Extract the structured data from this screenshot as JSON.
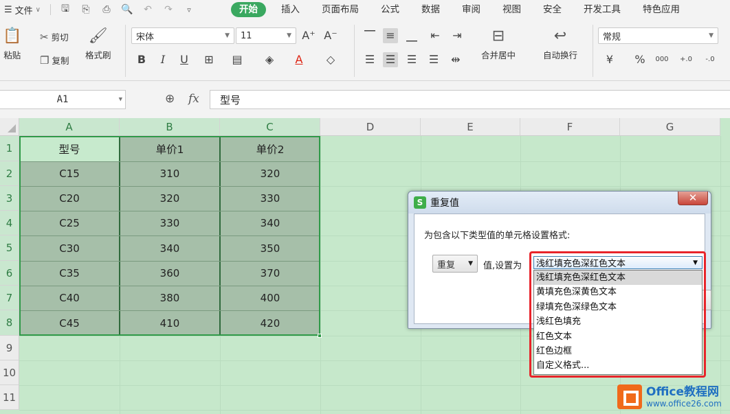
{
  "menubar": {
    "file_label": "文件",
    "tabs": [
      "开始",
      "插入",
      "页面布局",
      "公式",
      "数据",
      "审阅",
      "视图",
      "安全",
      "开发工具",
      "特色应用"
    ],
    "active_tab": "开始"
  },
  "ribbon": {
    "paste": "粘贴",
    "cut": "剪切",
    "copy": "复制",
    "format_painter": "格式刷",
    "font_name": "宋体",
    "font_size": "11",
    "grow_font": "A⁺",
    "shrink_font": "A⁻",
    "bold": "B",
    "italic": "I",
    "underline": "U",
    "merge_center": "合并居中",
    "wrap_text": "自动换行",
    "number_format": "常规",
    "percent": "%",
    "thousands": "000",
    "inc_decimal": "+.0",
    "dec_decimal": "-.0"
  },
  "formula_bar": {
    "name_box": "A1",
    "fx": "fx",
    "content": "型号"
  },
  "sheet": {
    "columns": [
      "A",
      "B",
      "C",
      "D",
      "E",
      "F",
      "G"
    ],
    "rows": [
      "1",
      "2",
      "3",
      "4",
      "5",
      "6",
      "7",
      "8",
      "9",
      "10",
      "11"
    ],
    "header": [
      "型号",
      "单价1",
      "单价2"
    ],
    "data": [
      [
        "C15",
        "310",
        "320"
      ],
      [
        "C20",
        "320",
        "330"
      ],
      [
        "C25",
        "330",
        "340"
      ],
      [
        "C30",
        "340",
        "350"
      ],
      [
        "C35",
        "360",
        "370"
      ],
      [
        "C40",
        "380",
        "400"
      ],
      [
        "C45",
        "410",
        "420"
      ]
    ]
  },
  "dialog": {
    "title": "重复值",
    "close": "✕",
    "prompt": "为包含以下类型值的单元格设置格式:",
    "type_select": "重复",
    "set_label": "值,设置为",
    "format_select": "浅红填充色深红色文本",
    "options": [
      "浅红填充色深红色文本",
      "黄填充色深黄色文本",
      "绿填充色深绿色文本",
      "浅红色填充",
      "红色文本",
      "红色边框",
      "自定义格式..."
    ]
  },
  "watermark": {
    "brand": "Office教程网",
    "url": "www.office26.com"
  }
}
